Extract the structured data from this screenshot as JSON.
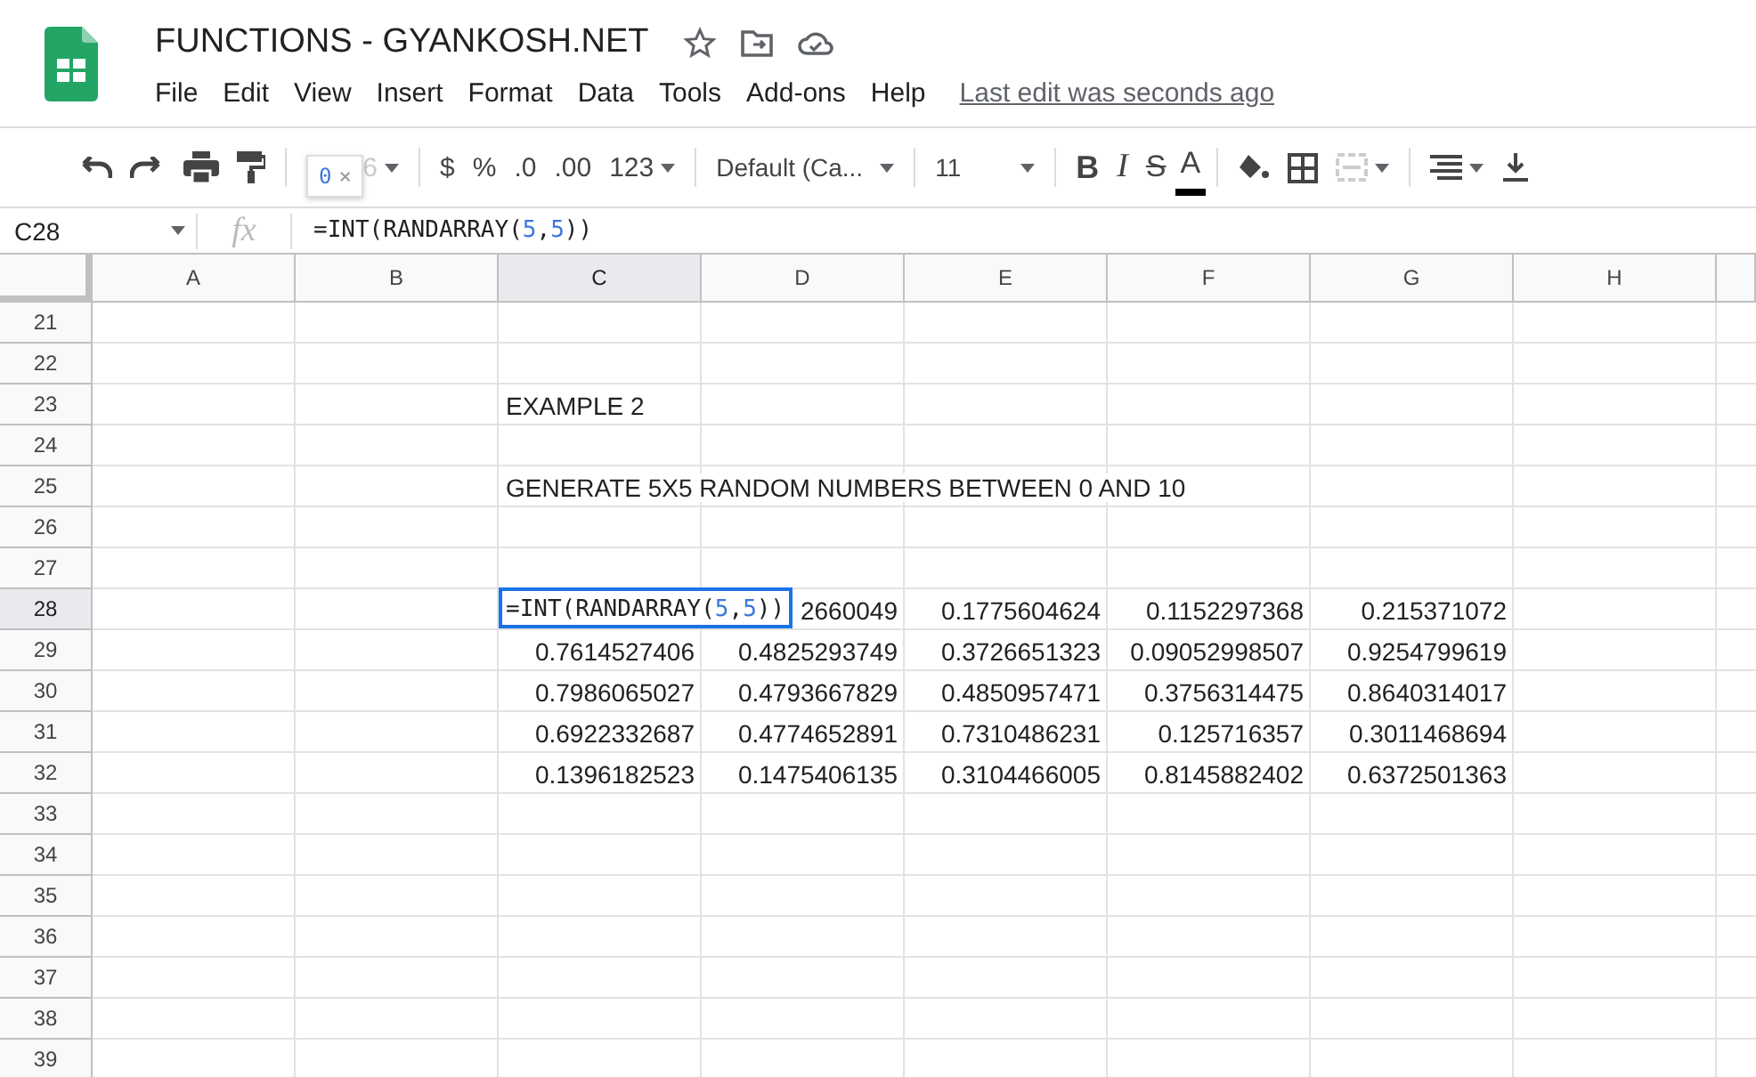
{
  "document": {
    "title": "FUNCTIONS - GYANKOSH.NET",
    "last_edit": "Last edit was seconds ago"
  },
  "menu": [
    "File",
    "Edit",
    "View",
    "Insert",
    "Format",
    "Data",
    "Tools",
    "Add-ons",
    "Help"
  ],
  "toolbar": {
    "zoom": "6",
    "tooltip": {
      "value": "0",
      "close": "×"
    },
    "currency": "$",
    "percent": "%",
    "decrease_decimals": ".0",
    "increase_decimals": ".00",
    "more_formats": "123",
    "font": "Default (Ca...",
    "font_size": "11",
    "bold": "B",
    "italic": "I",
    "strikethrough": "S",
    "text_color": "A"
  },
  "formula_bar": {
    "cell_ref": "C28",
    "fx": "fx",
    "formula": [
      {
        "text": "=INT(RANDARRAY(",
        "kind": "plain"
      },
      {
        "text": "5",
        "kind": "number"
      },
      {
        "text": ",",
        "kind": "plain"
      },
      {
        "text": "5",
        "kind": "number"
      },
      {
        "text": "))",
        "kind": "plain"
      }
    ]
  },
  "columns": [
    {
      "label": "A",
      "selected": false
    },
    {
      "label": "B",
      "selected": false
    },
    {
      "label": "C",
      "selected": true
    },
    {
      "label": "D",
      "selected": false
    },
    {
      "label": "E",
      "selected": false
    },
    {
      "label": "F",
      "selected": false
    },
    {
      "label": "G",
      "selected": false
    },
    {
      "label": "H",
      "selected": false
    }
  ],
  "rows": [
    {
      "number": "21",
      "selected": false
    },
    {
      "number": "22",
      "selected": false
    },
    {
      "number": "23",
      "selected": false,
      "C": {
        "kind": "text",
        "text": "EXAMPLE 2"
      }
    },
    {
      "number": "24",
      "selected": false
    },
    {
      "number": "25",
      "selected": false,
      "C": {
        "kind": "text",
        "text": "GENERATE 5X5 RANDOM NUMBERS BETWEEN 0 AND 10"
      }
    },
    {
      "number": "26",
      "selected": false
    },
    {
      "number": "27",
      "selected": false
    },
    {
      "number": "28",
      "selected": true,
      "C": {
        "kind": "editor",
        "tokens": [
          {
            "text": "=INT(RANDARRAY(",
            "kind": "plain"
          },
          {
            "text": "5",
            "kind": "number"
          },
          {
            "text": ",",
            "kind": "plain"
          },
          {
            "text": "5",
            "kind": "number"
          },
          {
            "text": "))",
            "kind": "plain"
          }
        ]
      },
      "D": {
        "kind": "number",
        "text": "2660049"
      },
      "E": {
        "kind": "number",
        "text": "0.1775604624"
      },
      "F": {
        "kind": "number",
        "text": "0.1152297368"
      },
      "G": {
        "kind": "number",
        "text": "0.215371072"
      }
    },
    {
      "number": "29",
      "selected": false,
      "C": {
        "kind": "number",
        "text": "0.7614527406"
      },
      "D": {
        "kind": "number",
        "text": "0.4825293749"
      },
      "E": {
        "kind": "number",
        "text": "0.3726651323"
      },
      "F": {
        "kind": "number",
        "text": "0.09052998507"
      },
      "G": {
        "kind": "number",
        "text": "0.9254799619"
      }
    },
    {
      "number": "30",
      "selected": false,
      "C": {
        "kind": "number",
        "text": "0.7986065027"
      },
      "D": {
        "kind": "number",
        "text": "0.4793667829"
      },
      "E": {
        "kind": "number",
        "text": "0.4850957471"
      },
      "F": {
        "kind": "number",
        "text": "0.3756314475"
      },
      "G": {
        "kind": "number",
        "text": "0.8640314017"
      }
    },
    {
      "number": "31",
      "selected": false,
      "C": {
        "kind": "number",
        "text": "0.6922332687"
      },
      "D": {
        "kind": "number",
        "text": "0.4774652891"
      },
      "E": {
        "kind": "number",
        "text": "0.7310486231"
      },
      "F": {
        "kind": "number",
        "text": "0.125716357"
      },
      "G": {
        "kind": "number",
        "text": "0.3011468694"
      }
    },
    {
      "number": "32",
      "selected": false,
      "C": {
        "kind": "number",
        "text": "0.1396182523"
      },
      "D": {
        "kind": "number",
        "text": "0.1475406135"
      },
      "E": {
        "kind": "number",
        "text": "0.3104466005"
      },
      "F": {
        "kind": "number",
        "text": "0.8145882402"
      },
      "G": {
        "kind": "number",
        "text": "0.6372501363"
      }
    },
    {
      "number": "33",
      "selected": false
    },
    {
      "number": "34",
      "selected": false
    },
    {
      "number": "35",
      "selected": false
    },
    {
      "number": "36",
      "selected": false
    },
    {
      "number": "37",
      "selected": false
    },
    {
      "number": "38",
      "selected": false
    },
    {
      "number": "39",
      "selected": false
    }
  ]
}
